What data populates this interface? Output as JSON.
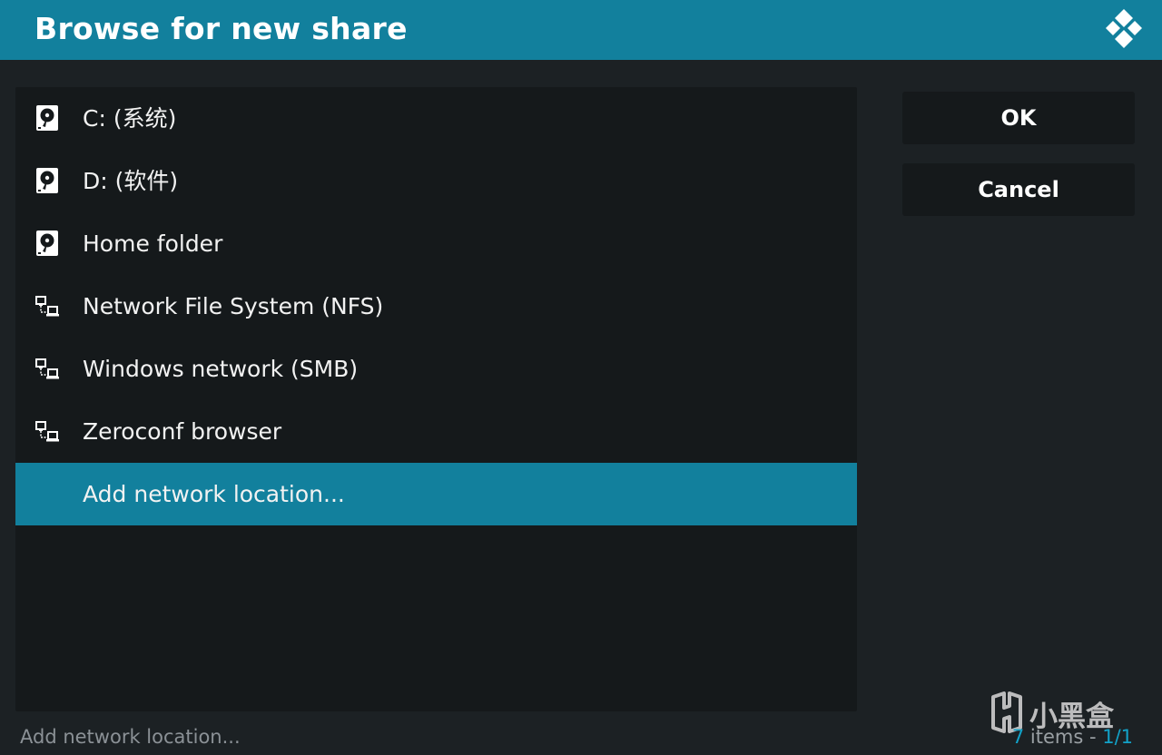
{
  "header": {
    "title": "Browse for new share",
    "logo_icon": "kodi-logo-icon"
  },
  "list": {
    "items": [
      {
        "label": "C: (系统)",
        "icon": "hard-drive-icon"
      },
      {
        "label": "D: (软件)",
        "icon": "hard-drive-icon"
      },
      {
        "label": "Home folder",
        "icon": "hard-drive-icon"
      },
      {
        "label": "Network File System (NFS)",
        "icon": "network-icon"
      },
      {
        "label": "Windows network (SMB)",
        "icon": "network-icon"
      },
      {
        "label": "Zeroconf browser",
        "icon": "network-icon"
      },
      {
        "label": "Add network location...",
        "icon": "",
        "selected": true
      }
    ]
  },
  "buttons": {
    "ok_label": "OK",
    "cancel_label": "Cancel"
  },
  "footer": {
    "selected_label": "Add network location...",
    "count": "7",
    "count_text": " items - ",
    "page": "1/1"
  },
  "watermark": {
    "text": "小黑盒"
  },
  "colors": {
    "accent": "#12809d",
    "background": "#1c2124",
    "panel": "#15191b"
  }
}
